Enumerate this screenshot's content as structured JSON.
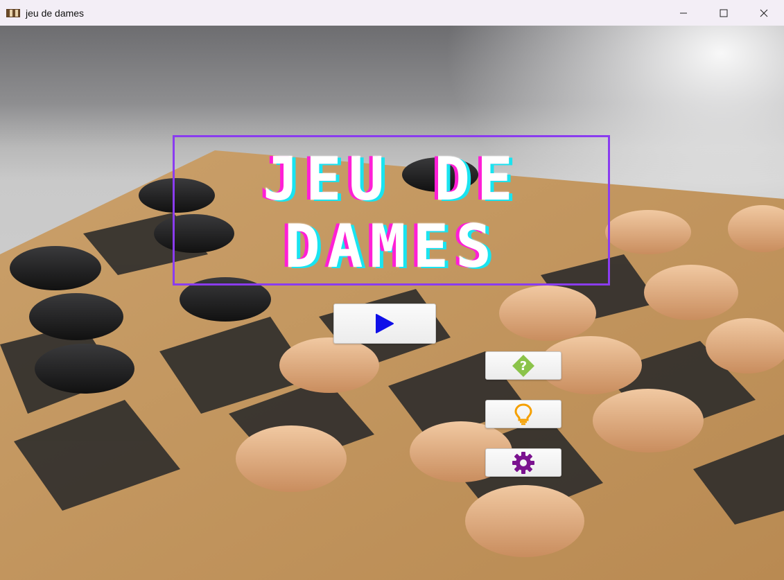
{
  "window": {
    "title": "jeu de dames",
    "icon": "checkerboard-icon",
    "controls": [
      "minimize-icon",
      "maximize-icon",
      "close-icon"
    ]
  },
  "game_title": {
    "line1": "JEU DE",
    "line2": "DAMES"
  },
  "buttons": {
    "play": {
      "icon": "play-icon",
      "color": "#1010e8"
    },
    "help": {
      "icon": "help-diamond-icon",
      "color": "#8bc34a"
    },
    "hint": {
      "icon": "lightbulb-icon",
      "color": "#f5a000"
    },
    "settings": {
      "icon": "gear-icon",
      "color": "#7b128f"
    }
  },
  "colors": {
    "title_frame": "#8a3cf0",
    "title_shadow_magenta": "#ff1fd6",
    "title_shadow_cyan": "#19e4f0"
  }
}
